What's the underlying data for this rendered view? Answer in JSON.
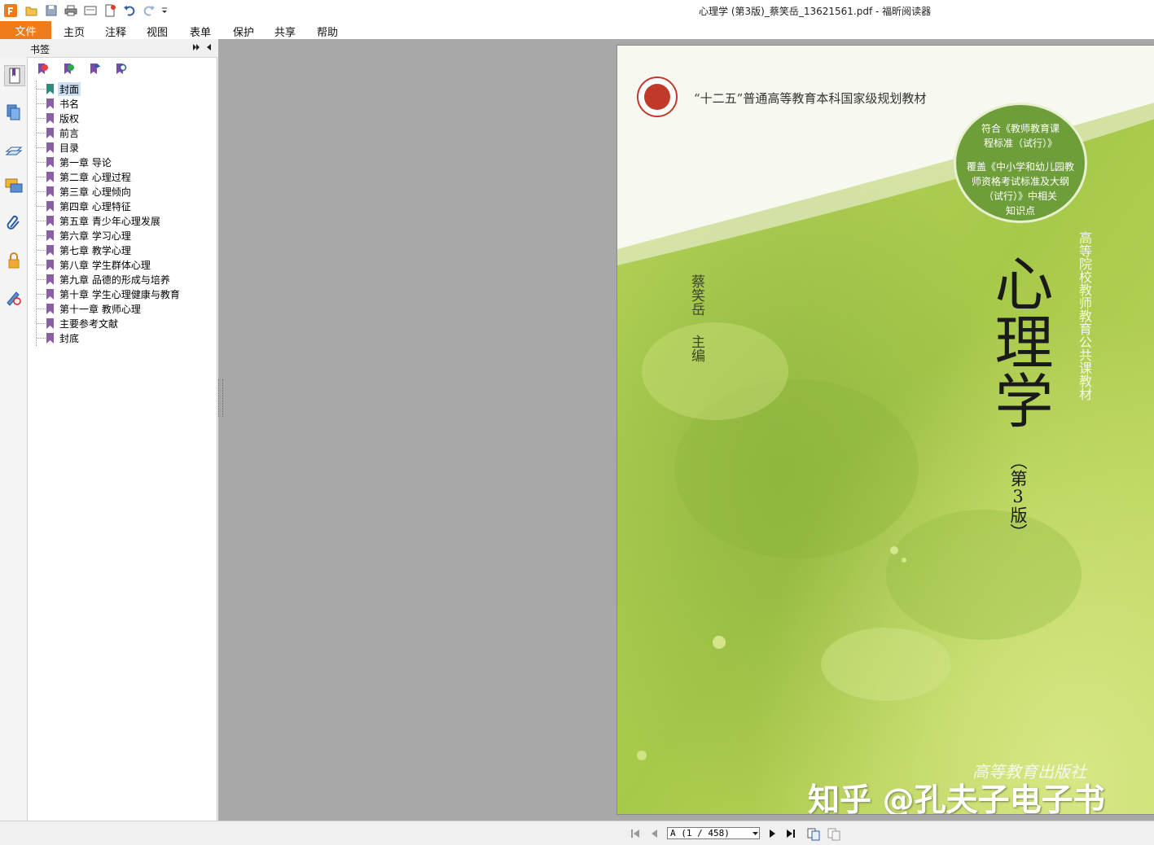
{
  "window": {
    "title": "心理学 (第3版)_蔡笑岳_13621561.pdf - 福昕阅读器"
  },
  "quick_access": [
    "app-logo-icon",
    "open-folder-icon",
    "save-icon",
    "print-icon",
    "page-setup-icon",
    "new-icon",
    "undo-icon",
    "redo-icon",
    "dropdown-icon"
  ],
  "menu": {
    "file": "文件",
    "items": [
      "主页",
      "注释",
      "视图",
      "表单",
      "保护",
      "共享",
      "帮助"
    ]
  },
  "panel": {
    "title": "书签"
  },
  "bookmarks": [
    "封面",
    "书名",
    "版权",
    "前言",
    "目录",
    "第一章 导论",
    "第二章 心理过程",
    "第三章 心理倾向",
    "第四章 心理特征",
    "第五章 青少年心理发展",
    "第六章 学习心理",
    "第七章 教学心理",
    "第八章 学生群体心理",
    "第九章 品德的形成与培养",
    "第十章 学生心理健康与教育",
    "第十一章 教师心理",
    "主要参考文献",
    "封底"
  ],
  "cover": {
    "series": "“十二五”普通高等教育本科国家级规划教材",
    "badge_line1": "符合《教师教育课",
    "badge_line2": "程标准（试行）》",
    "badge_line3": "覆盖《中小学和幼儿园教",
    "badge_line4": "师资格考试标准及大纲",
    "badge_line5": "（试行）》中相关",
    "badge_line6": "知识点",
    "title": "心理学",
    "edition": "（第3版）",
    "author": "蔡笑岳",
    "author_role": "主编",
    "subtitle": "高等院校教师教育公共课教材",
    "publisher": "高等教育出版社",
    "watermark": "知乎 @孔夫子电子书"
  },
  "status": {
    "page_input": "A  (1 / 458)"
  },
  "colors": {
    "accent": "#f07b1a",
    "cover_green": "#a6c94a",
    "badge_green": "#6e9e3a",
    "bookmark_flag": "#8b5fa8",
    "bookmark_flag_selected": "#2c8d7f"
  }
}
